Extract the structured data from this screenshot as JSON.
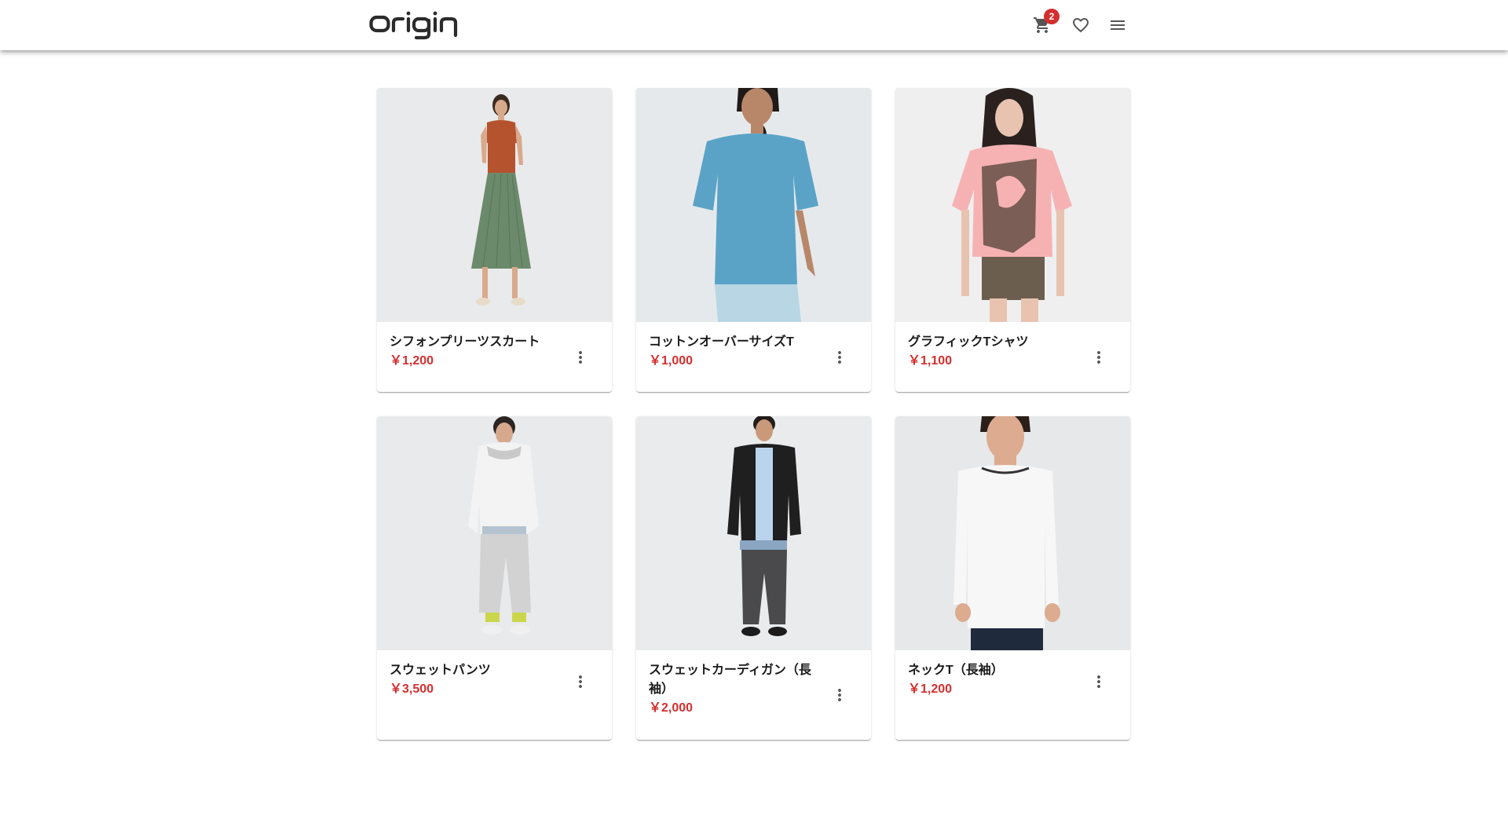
{
  "header": {
    "logo_text": "Origin",
    "cart_badge": "2",
    "icons": [
      "cart-icon",
      "heart-icon",
      "menu-icon"
    ]
  },
  "products": [
    {
      "title": "シフォンプリーツスカート",
      "price": "￥1,200",
      "image": "woman-orange-top-green-pleated-skirt"
    },
    {
      "title": "コットンオーバーサイズT",
      "price": "￥1,000",
      "image": "woman-blue-oversized-tshirt"
    },
    {
      "title": "グラフィックTシャツ",
      "price": "￥1,100",
      "image": "woman-pink-graphic-tshirt"
    },
    {
      "title": "スウェットパンツ",
      "price": "￥3,500",
      "image": "man-white-hoodie-grey-sweatpants"
    },
    {
      "title": "スウェットカーディガン（長袖）",
      "price": "￥2,000",
      "image": "man-black-cardigan"
    },
    {
      "title": "ネックT（長袖）",
      "price": "￥1,200",
      "image": "man-white-longsleeve-tshirt"
    }
  ],
  "colors": {
    "price": "#d32f2f",
    "badge": "#d32f2f",
    "icon": "#555555",
    "media_bg": "#eceeef"
  }
}
